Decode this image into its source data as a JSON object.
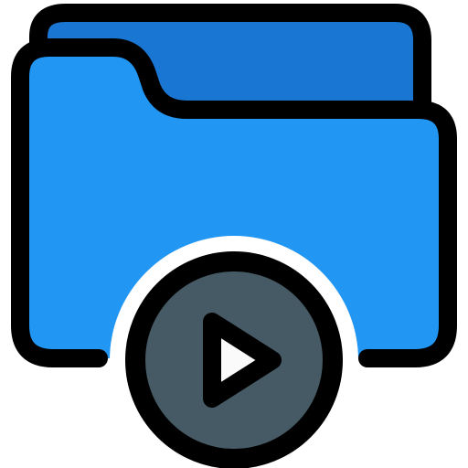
{
  "icon": {
    "name": "video-folder-icon",
    "colors": {
      "outline": "#000000",
      "folder_back": "#1976d2",
      "folder_front": "#2196f3",
      "badge": "#455a64",
      "play": "#fafafa",
      "background": "#ffffff"
    }
  }
}
